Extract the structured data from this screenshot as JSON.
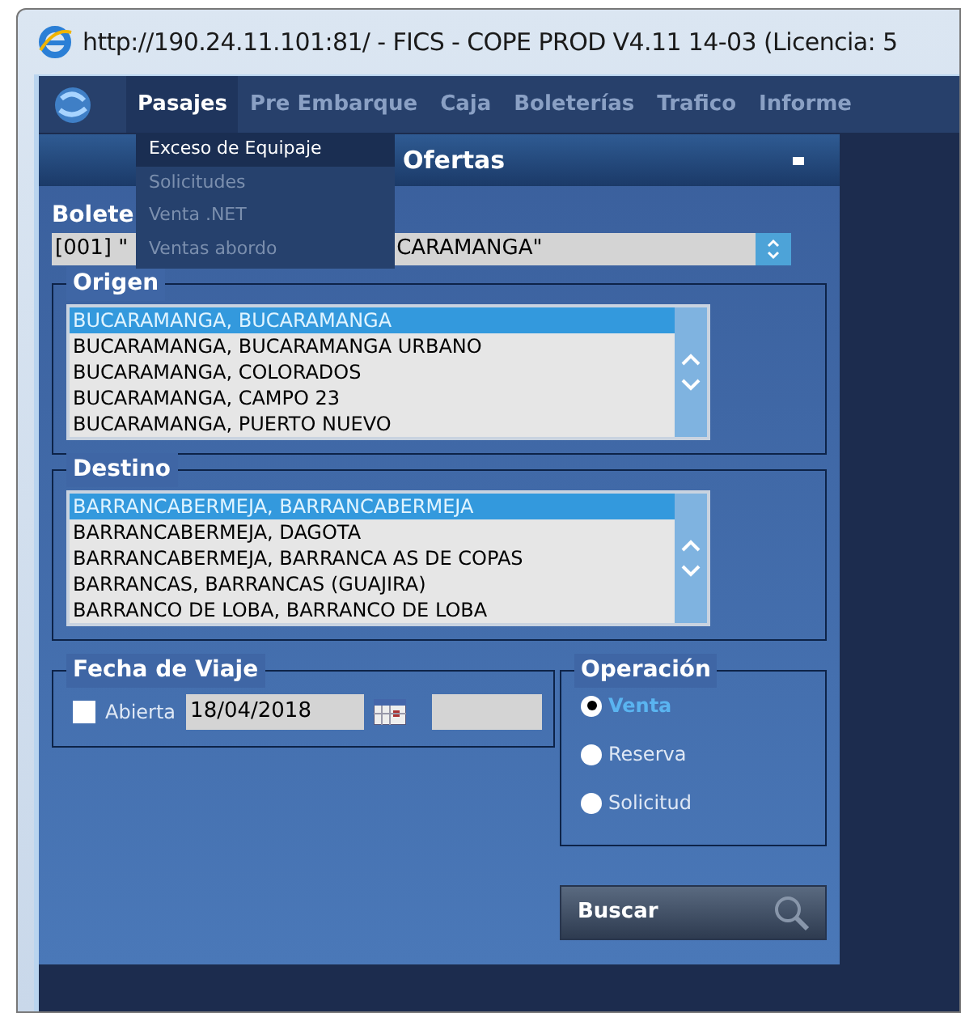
{
  "window": {
    "title": "http://190.24.11.101:81/ - FICS - COPE PROD V4.11 14-03 (Licencia: 5"
  },
  "menu": [
    {
      "label": "Pasajes",
      "selected": true
    },
    {
      "label": "Pre Embarque",
      "selected": false
    },
    {
      "label": "Caja",
      "selected": false
    },
    {
      "label": "Boleterías",
      "selected": false
    },
    {
      "label": "Trafico",
      "selected": false
    },
    {
      "label": "Informe",
      "selected": false
    }
  ],
  "dropdown": [
    {
      "label": "Exceso de Equipaje",
      "disabled": false
    },
    {
      "label": "Solicitudes",
      "disabled": true
    },
    {
      "label": "Venta .NET",
      "disabled": true
    },
    {
      "label": "Ventas abordo",
      "disabled": true
    }
  ],
  "panel": {
    "title": "Ofertas",
    "boleteria_label": "Bolete",
    "boleteria_value_left": "[001] \"",
    "boleteria_value_right": "CARAMANGA\""
  },
  "origen": {
    "legend": "Origen",
    "items": [
      {
        "label": "BUCARAMANGA, BUCARAMANGA",
        "selected": true
      },
      {
        "label": "BUCARAMANGA, BUCARAMANGA URBANO",
        "selected": false
      },
      {
        "label": "BUCARAMANGA, COLORADOS",
        "selected": false
      },
      {
        "label": "BUCARAMANGA, CAMPO 23",
        "selected": false
      },
      {
        "label": "BUCARAMANGA, PUERTO NUEVO",
        "selected": false
      }
    ]
  },
  "destino": {
    "legend": "Destino",
    "items": [
      {
        "label": "BARRANCABERMEJA, BARRANCABERMEJA",
        "selected": true
      },
      {
        "label": "BARRANCABERMEJA, DAGOTA",
        "selected": false
      },
      {
        "label": "BARRANCABERMEJA, BARRANCA AS DE COPAS",
        "selected": false
      },
      {
        "label": "BARRANCAS, BARRANCAS (GUAJIRA)",
        "selected": false
      },
      {
        "label": "BARRANCO DE LOBA, BARRANCO DE LOBA",
        "selected": false
      }
    ]
  },
  "fecha": {
    "legend": "Fecha de Viaje",
    "abierta_label": "Abierta",
    "abierta_checked": false,
    "date": "18/04/2018"
  },
  "operacion": {
    "legend": "Operación",
    "options": [
      {
        "label": "Venta",
        "selected": true
      },
      {
        "label": "Reserva",
        "selected": false
      },
      {
        "label": "Solicitud",
        "selected": false
      }
    ]
  },
  "search_button": "Buscar"
}
